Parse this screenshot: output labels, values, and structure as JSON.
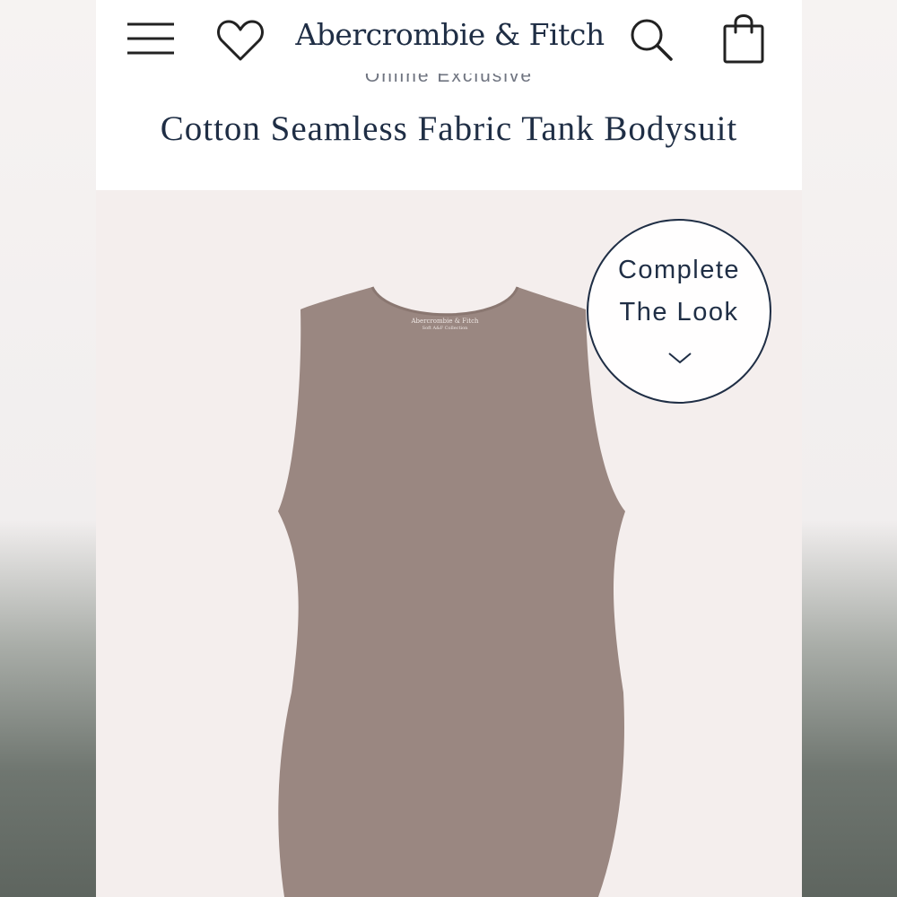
{
  "header": {
    "brand": "Abercrombie & Fitch",
    "icons": {
      "menu": "hamburger-menu-icon",
      "wishlist": "heart-icon",
      "search": "search-icon",
      "bag": "shopping-bag-icon"
    }
  },
  "product": {
    "eyebrow": "Online Exclusive",
    "title": "Cotton Seamless Fabric Tank Bodysuit",
    "label_brand": "Abercrombie & Fitch",
    "label_sub": "Soft A&F Collection"
  },
  "complete_the_look": {
    "line1": "Complete",
    "line2": "The Look",
    "icon": "chevron-down-icon"
  },
  "colors": {
    "brand_navy": "#1f2e45",
    "garment": "#9a8781",
    "image_bg": "#f4eeed"
  }
}
